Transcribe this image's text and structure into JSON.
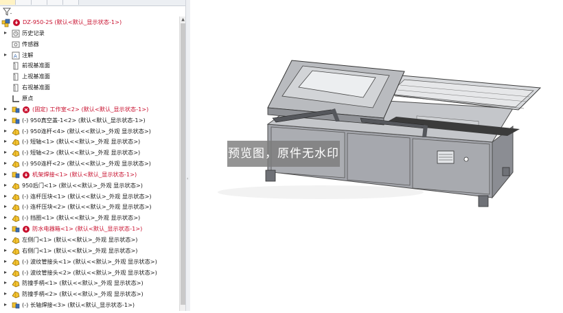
{
  "feature_tree": {
    "items": [
      {
        "label": "DZ-950-2S  (默认<默认_显示状态-1>)",
        "color": "red",
        "icon": "assembly-icon",
        "status_icon": "rebuild-error-icon",
        "expander": false
      },
      {
        "label": "历史记录",
        "color": "normal",
        "icon": "history-folder-icon",
        "expander": true
      },
      {
        "label": "传感器",
        "color": "normal",
        "icon": "sensor-icon",
        "expander": false
      },
      {
        "label": "注解",
        "color": "normal",
        "icon": "annotations-icon",
        "expander": true
      },
      {
        "label": "前视基准面",
        "color": "normal",
        "icon": "plane-icon",
        "expander": false
      },
      {
        "label": "上视基准面",
        "color": "normal",
        "icon": "plane-icon",
        "expander": false
      },
      {
        "label": "右视基准面",
        "color": "normal",
        "icon": "plane-icon",
        "expander": false
      },
      {
        "label": "原点",
        "color": "normal",
        "icon": "origin-icon",
        "expander": false
      },
      {
        "label": "(固定) 工作室<2> (默认<默认_显示状态-1>)",
        "color": "red",
        "icon": "subassembly-icon",
        "status_icon": "error-x-icon",
        "expander": true
      },
      {
        "label": "(-) 950真空盖-1<2> (默认<默认_显示状态-1>)",
        "color": "normal",
        "icon": "subassembly-icon",
        "expander": true
      },
      {
        "label": "(-) 950连杆<4> (默认<<默认>_外观 显示状态>)",
        "color": "normal",
        "icon": "part-icon",
        "expander": true
      },
      {
        "label": "(-) 短轴<1> (默认<<默认>_外观 显示状态>)",
        "color": "normal",
        "icon": "part-icon",
        "expander": true
      },
      {
        "label": "(-) 短轴<2> (默认<<默认>_外观 显示状态>)",
        "color": "normal",
        "icon": "part-icon",
        "expander": true
      },
      {
        "label": "(-) 950连杆<2> (默认<<默认>_外观 显示状态>)",
        "color": "normal",
        "icon": "part-icon",
        "expander": true
      },
      {
        "label": "机架焊接<1> (默认<默认_显示状态-1>)",
        "color": "red",
        "icon": "subassembly-icon",
        "status_icon": "rebuild-error-icon",
        "expander": true
      },
      {
        "label": "950后门<1> (默认<<默认>_外观 显示状态>)",
        "color": "normal",
        "icon": "part-icon",
        "expander": true
      },
      {
        "label": "(-) 连杆压块<1> (默认<<默认>_外观 显示状态>)",
        "color": "normal",
        "icon": "part-icon",
        "expander": true
      },
      {
        "label": "(-) 连杆压块<2> (默认<<默认>_外观 显示状态>)",
        "color": "normal",
        "icon": "part-icon",
        "expander": true
      },
      {
        "label": "(-) 挡圈<1> (默认<<默认>_外观 显示状态>)",
        "color": "normal",
        "icon": "part-icon",
        "expander": true
      },
      {
        "label": "防水电器箱<1> (默认<默认_显示状态-1>)",
        "color": "red",
        "icon": "subassembly-icon",
        "status_icon": "rebuild-error-icon",
        "expander": true
      },
      {
        "label": "左侧门<1> (默认<<默认>_外观 显示状态>)",
        "color": "normal",
        "icon": "part-icon",
        "expander": true
      },
      {
        "label": "右侧门<1> (默认<<默认>_外观 显示状态>)",
        "color": "normal",
        "icon": "part-icon",
        "expander": true
      },
      {
        "label": "(-) 波纹管接头<1> (默认<<默认>_外观 显示状态>)",
        "color": "normal",
        "icon": "part-icon",
        "expander": true
      },
      {
        "label": "(-) 波纹管接头<2> (默认<<默认>_外观 显示状态>)",
        "color": "normal",
        "icon": "part-icon",
        "expander": true
      },
      {
        "label": "防撞手柄<1> (默认<<默认>_外观 显示状态>)",
        "color": "normal",
        "icon": "part-icon",
        "expander": true
      },
      {
        "label": "防撞手柄<2> (默认<<默认>_外观 显示状态>)",
        "color": "normal",
        "icon": "part-icon",
        "expander": true
      },
      {
        "label": "(-) 长轴焊接<3> (默认<默认_显示状态-1>)",
        "color": "normal",
        "icon": "subassembly-icon",
        "expander": true
      }
    ]
  },
  "viewport": {
    "watermark": "预览图，原件无水印"
  },
  "colors": {
    "error_red": "#c8102e",
    "part_yellow": "#f2c230",
    "assembly_blue": "#3d6fb3",
    "machine_steel": "#a9aab0"
  }
}
